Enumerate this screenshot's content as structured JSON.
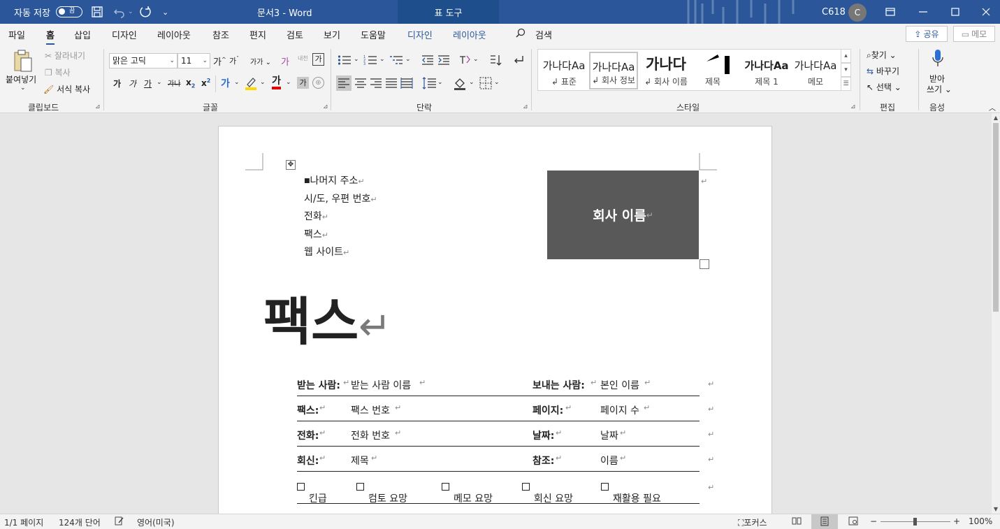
{
  "titlebar": {
    "autosave_label": "자동 저장",
    "autosave_state": "끔",
    "doc_title": "문서3  -  Word",
    "context_tab_group": "표 도구",
    "user_id": "C618",
    "avatar_initial": "C",
    "qat_save_icon": "save-icon",
    "qat_undo_icon": "undo-icon",
    "qat_redo_icon": "redo-icon"
  },
  "tabs": {
    "file": "파일",
    "home": "홈",
    "insert": "삽입",
    "design": "디자인",
    "layout": "레이아웃",
    "references": "참조",
    "mailings": "편지",
    "review": "검토",
    "view": "보기",
    "help": "도움말",
    "table_design": "디자인",
    "table_layout": "레이아웃",
    "search": "검색",
    "share": "공유",
    "memo": "메모"
  },
  "clipboard": {
    "paste": "붙여넣기",
    "cut": "잘라내기",
    "copy": "복사",
    "format_painter": "서식 복사",
    "group_label": "클립보드"
  },
  "font": {
    "font_name": "맑은 고딕",
    "font_size": "11",
    "group_label": "글꼴",
    "bold": "가",
    "italic": "가",
    "underline": "가",
    "strike": "가나",
    "subscript": "x",
    "superscript": "x",
    "sub_mark": "2",
    "sup_mark": "2",
    "grow": "가",
    "shrink": "가",
    "case": "가가",
    "clear": "가",
    "phonetic": "내천",
    "border_char": "가",
    "effects": "가",
    "highlight": "가",
    "font_color": "가",
    "shading": "가",
    "enclose": "⊕"
  },
  "paragraph": {
    "group_label": "단락"
  },
  "styles": {
    "group_label": "스타일",
    "items": [
      {
        "preview": "가나다Aa",
        "name": "표준"
      },
      {
        "preview": "가나다Aa",
        "name": "회사 정보"
      },
      {
        "preview": "가나다",
        "name": "회사 이름"
      },
      {
        "preview": "",
        "name": "제목"
      },
      {
        "preview": "가나다Aa",
        "name": "제목 1"
      },
      {
        "preview": "가나다Aa",
        "name": "메모"
      }
    ]
  },
  "editing": {
    "find": "찾기",
    "replace": "바꾸기",
    "select": "선택",
    "group_label": "편집"
  },
  "voice": {
    "dictate_1": "받아",
    "dictate_2": "쓰기",
    "group_label": "음성"
  },
  "document": {
    "address_lines": [
      "나머지 주소",
      "시/도, 우편 번호",
      "전화",
      "팩스",
      "웹 사이트"
    ],
    "company_name": "회사 이름",
    "fax_title": "팩스",
    "rows": [
      {
        "l1": "받는 사람:",
        "v1": "받는 사람 이름",
        "l2": "보내는 사람:",
        "v2": "본인 이름"
      },
      {
        "l1": "팩스:",
        "v1": "팩스 번호",
        "l2": "페이지:",
        "v2": "페이지 수"
      },
      {
        "l1": "전화:",
        "v1": "전화 번호",
        "l2": "날짜:",
        "v2": "날짜"
      },
      {
        "l1": "회신:",
        "v1": "제목",
        "l2": "참조:",
        "v2": "이름"
      }
    ],
    "checkboxes": [
      "긴급",
      "검토 요망",
      "메모 요망",
      "회신 요망",
      "재활용 필요"
    ]
  },
  "status": {
    "page": "1/1 페이지",
    "words": "124개 단어",
    "language": "영어(미국)",
    "focus": "포커스",
    "zoom": "100%",
    "zoom_minus": "−",
    "zoom_plus": "+"
  },
  "colors": {
    "titlebar": "#2b579a",
    "logo_box": "#595959",
    "highlight_yellow": "#ffd800",
    "font_red": "#e00000"
  }
}
